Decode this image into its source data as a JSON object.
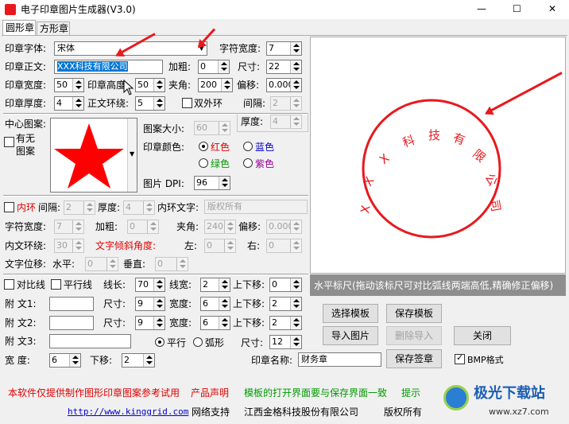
{
  "window": {
    "title": "电子印章图片生成器(V3.0)",
    "minimize": "—",
    "maximize": "☐",
    "close": "✕"
  },
  "tabs": [
    {
      "label": "圆形章"
    },
    {
      "label": "方形章"
    }
  ],
  "seal": {
    "font_label": "印章字体:",
    "font_value": "宋体",
    "char_width_label": "字符宽度:",
    "char_width": "7",
    "text_label": "印章正文:",
    "text_value": "XXX科技有限公司",
    "bold_label": "加粗:",
    "bold": "0",
    "size_label": "尺寸:",
    "size": "22",
    "width_label": "印章宽度:",
    "width": "50",
    "height_label": "印章高度:",
    "height": "50",
    "angle_label": "夹角:",
    "angle": "200",
    "offset_label": "偏移:",
    "offset": "0.000",
    "thickness_label": "印章厚度:",
    "thickness": "4",
    "ring_label": "正文环绕:",
    "ring": "5",
    "double_ring_label": "双外环",
    "gap_label": "间隔:",
    "gap": "2",
    "thickness2_label": "厚度:",
    "thickness2": "4"
  },
  "center": {
    "label": "中心图案:",
    "has_label": "有无图案",
    "size_label": "图案大小:",
    "size": "60",
    "color_label": "印章颜色:",
    "colors": [
      "红色",
      "蓝色",
      "绿色",
      "紫色"
    ],
    "dpi_label": "图片 DPI:",
    "dpi": "96"
  },
  "inner": {
    "inner_ring_label": "内环",
    "gap_label": "间隔:",
    "gap": "2",
    "thickness_label": "厚度:",
    "thickness": "4",
    "text_label": "内环文字:",
    "text_value": "版权所有",
    "char_width_label": "字符宽度:",
    "char_width": "7",
    "bold_label": "加粗:",
    "bold": "0",
    "angle_label": "夹角:",
    "angle": "240",
    "offset_label": "偏移:",
    "offset": "0.000",
    "ring_label": "内文环绕:",
    "ring": "30",
    "tilt_label": "文字倾斜角度:",
    "left_label": "左:",
    "left": "0",
    "right_label": "右:",
    "right": "0",
    "shift_label": "文字位移:",
    "h_label": "水平:",
    "h": "0",
    "v_label": "垂直:",
    "v": "0"
  },
  "lines": {
    "compare_label": "对比线",
    "parallel_label": "平行线",
    "length_label": "线长:",
    "length": "70",
    "width_label": "线宽:",
    "width": "2",
    "move_label": "上下移:",
    "move": "0",
    "t1_label": "附  文1:",
    "t1_size_label": "尺寸:",
    "t1_size": "9",
    "t1_width_label": "宽度:",
    "t1_width": "6",
    "t1_move_label": "上下移:",
    "t1_move": "2",
    "t2_label": "附  文2:",
    "t2_size_label": "尺寸:",
    "t2_size": "9",
    "t2_width_label": "宽度:",
    "t2_width": "6",
    "t2_move_label": "上下移:",
    "t2_move": "2",
    "t3_label": "附  文3:",
    "parallel_radio": "平行",
    "arc_radio": "弧形",
    "t3_size_label": "尺寸:",
    "t3_size": "12",
    "wd_label": "宽   度:",
    "wd": "6",
    "down_label": "下移:",
    "down": "2",
    "seal_name_label": "印章名称:",
    "seal_name": "财务章"
  },
  "preview": {
    "ruler_text": "水平标尺(拖动该标尺可对比弧线两端高低,精确修正偏移)",
    "seal_text": "XXX科技有限公司",
    "seal_color": "#e8191e"
  },
  "buttons": {
    "select_template": "选择模板",
    "save_template": "保存模板",
    "import_image": "导入图片",
    "delete_import": "删除导入",
    "close": "关闭",
    "save_seal": "保存签章",
    "bmp_label": "BMP格式"
  },
  "footer": {
    "notice": "本软件仅提供制作图形印章图案参考试用",
    "product": "产品声明",
    "template_note": "模板的打开界面要与保存界面一致",
    "hint": "提示",
    "url": "http://www.kinggrid.com",
    "support": "网络支持",
    "company": "江西金格科技股份有限公司",
    "copyright": "版权所有"
  },
  "watermark": {
    "name": "极光下载站",
    "url": "www.xz7.com"
  }
}
